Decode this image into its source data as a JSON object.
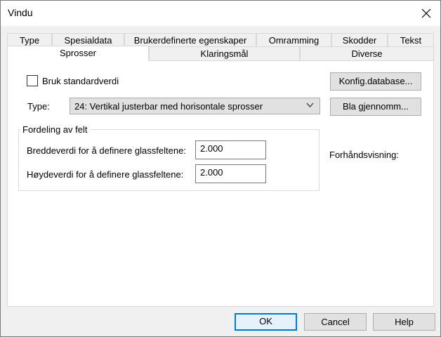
{
  "window": {
    "title": "Vindu"
  },
  "tabs_row1": [
    "Type",
    "Spesialdata",
    "Brukerdefinerte egenskaper",
    "Omramming",
    "Skodder",
    "Tekst"
  ],
  "tabs_row2": [
    "Sprosser",
    "Klaringsmål",
    "Diverse"
  ],
  "selected_tab": "Sprosser",
  "panel": {
    "use_default_label": "Bruk standardverdi",
    "use_default_checked": false,
    "config_button": "Konfig.database...",
    "type_label": "Type:",
    "type_value": "24:  Vertikal justerbar med horisontale sprosser",
    "browse_button": "Bla gjennomm...",
    "group_title": "Fordeling av felt",
    "width_label": "Breddeverdi for å definere glassfeltene:",
    "width_value": "2.000",
    "height_label": "Høydeverdi for å definere glassfeltene:",
    "height_value": "2.000",
    "preview_label": "Forhåndsvisning:"
  },
  "footer": {
    "ok": "OK",
    "cancel": "Cancel",
    "help": "Help"
  },
  "colors": {
    "accent": "#0078d7",
    "preview_frame": "#d8dcd4",
    "preview_sash": "#f4f1c6",
    "preview_glass": "#7fc8f0"
  },
  "icons": {
    "close": "close-icon",
    "dropdown": "chevron-down-icon"
  }
}
